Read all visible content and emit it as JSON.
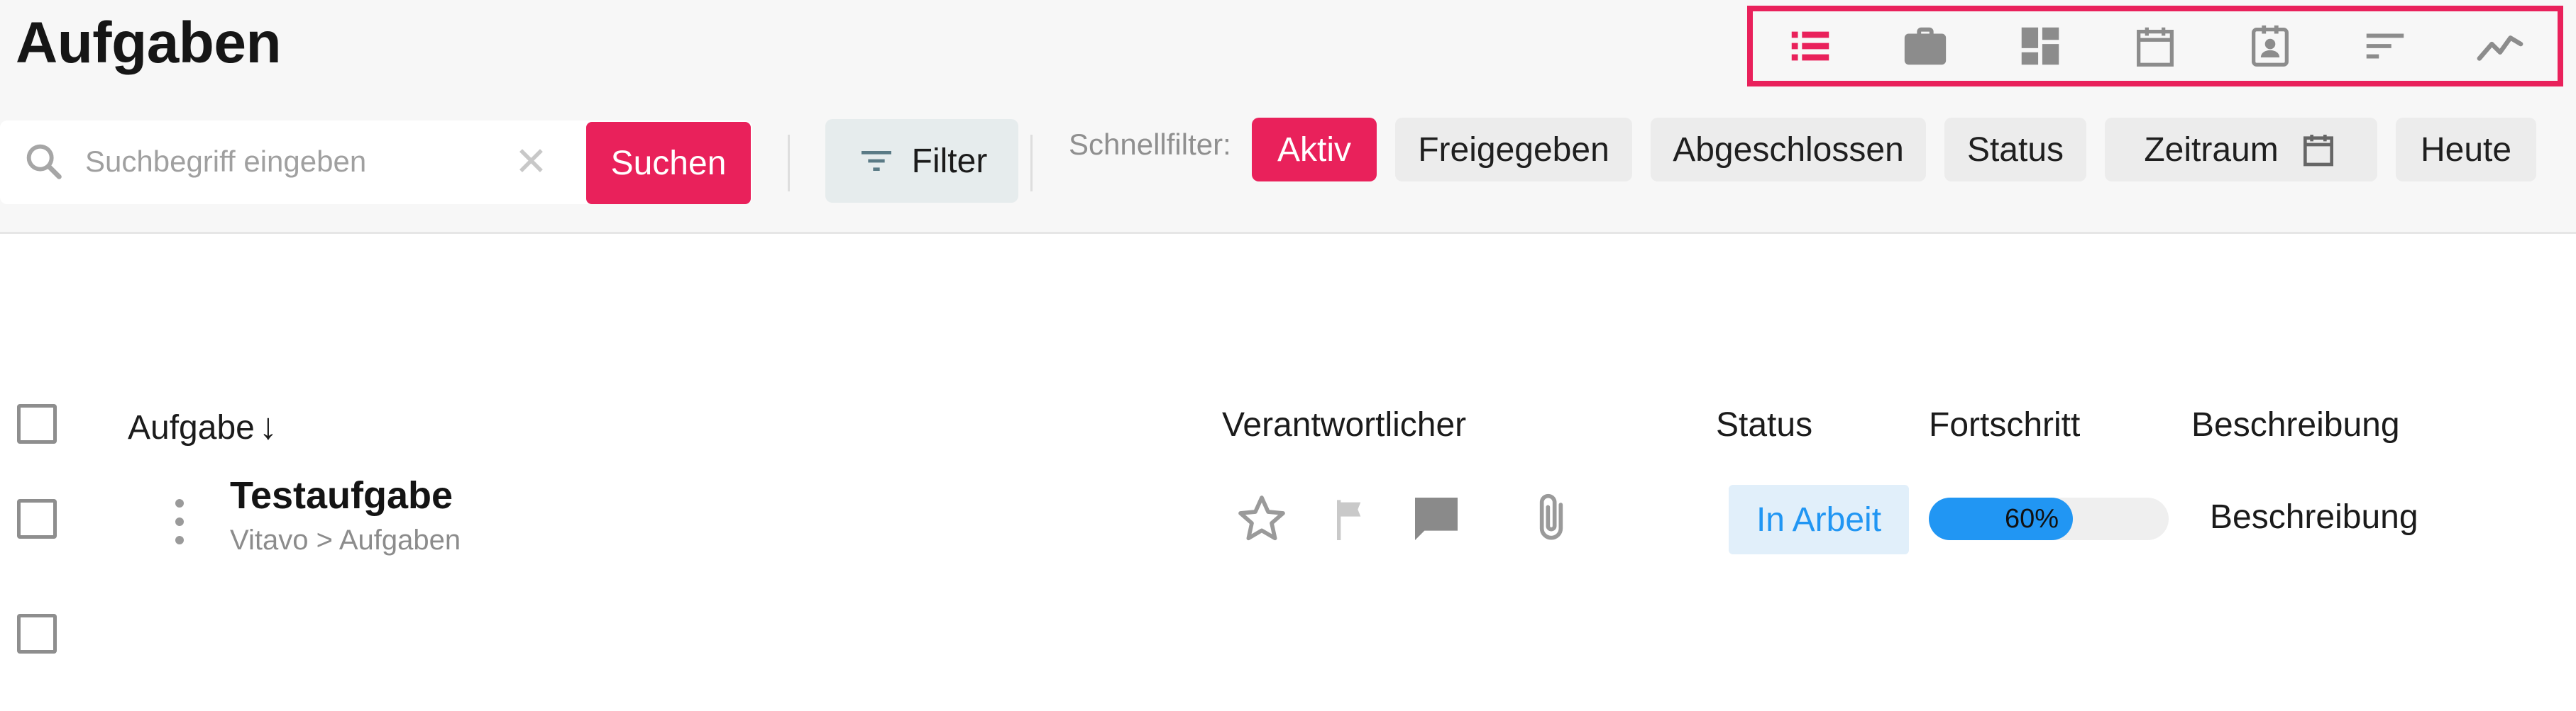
{
  "page": {
    "title": "Aufgaben"
  },
  "view_switcher": {
    "highlight_color": "#e9215b",
    "views": [
      {
        "icon": "list-view-icon",
        "active": true
      },
      {
        "icon": "briefcase-icon",
        "active": false
      },
      {
        "icon": "dashboard-icon",
        "active": false
      },
      {
        "icon": "calendar-icon",
        "active": false
      },
      {
        "icon": "contact-card-icon",
        "active": false
      },
      {
        "icon": "sort-lines-icon",
        "active": false
      },
      {
        "icon": "trend-chart-icon",
        "active": false
      }
    ]
  },
  "search": {
    "placeholder": "Suchbegriff eingeben",
    "value": "",
    "clear_symbol": "✕",
    "button_label": "Suchen"
  },
  "filter": {
    "label": "Filter"
  },
  "quick_filters": {
    "label": "Schnellfilter:",
    "items": [
      {
        "label": "Aktiv",
        "active": true
      },
      {
        "label": "Freigegeben",
        "active": false
      },
      {
        "label": "Abgeschlossen",
        "active": false
      },
      {
        "label": "Status",
        "active": false
      },
      {
        "label": "Zeitraum",
        "active": false,
        "icon": "calendar-icon"
      },
      {
        "label": "Heute",
        "active": false
      }
    ]
  },
  "table": {
    "columns": {
      "task": "Aufgabe",
      "task_sort_symbol": "↓",
      "owner": "Verantwortlicher",
      "status": "Status",
      "progress": "Fortschritt",
      "description": "Beschreibung"
    },
    "rows": [
      {
        "title": "Testaufgabe",
        "path": "Vitavo > Aufgaben",
        "status": "In Arbeit",
        "progress_percent": 60,
        "progress_label": "60%",
        "description": "Beschreibung",
        "icons": [
          "star-outline-icon",
          "flag-icon",
          "comment-icon",
          "attachment-icon"
        ]
      }
    ]
  },
  "colors": {
    "accent": "#e9215b",
    "status_blue": "#2196f3",
    "status_bg": "#e1effa"
  }
}
